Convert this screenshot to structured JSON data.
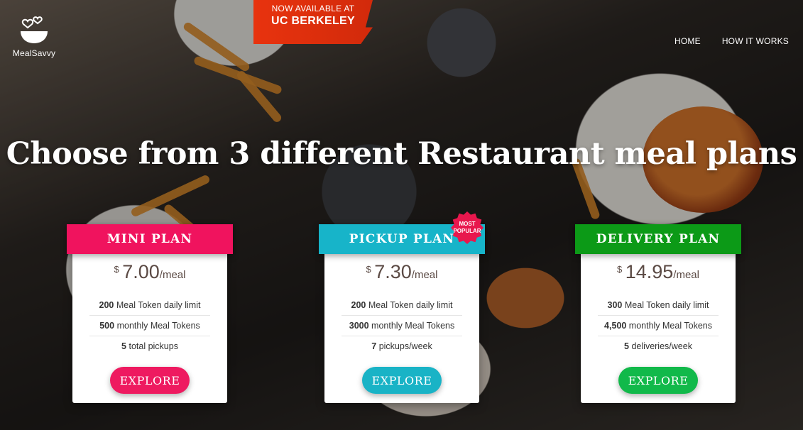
{
  "brand": {
    "name": "MealSavvy",
    "logo_icon": "bowl-hearts-icon"
  },
  "banner": {
    "line1": "NOW AVAILABLE AT",
    "line2": "UC BERKELEY"
  },
  "nav": {
    "home": "HOME",
    "how": "HOW IT WORKS"
  },
  "hero": {
    "title": "Choose from 3 different Restaurant meal plans"
  },
  "colors": {
    "mini": "#f0135e",
    "pickup": "#17b4c9",
    "delivery": "#0c9a17",
    "explore_mini": "#ee1a60",
    "explore_pickup": "#19b3c6",
    "explore_delivery": "#11b94a",
    "badge": "#e8174d"
  },
  "plans": [
    {
      "title": "MINI PLAN",
      "currency": "$",
      "price": "7.00",
      "unit": "/meal",
      "features": [
        {
          "value": "200",
          "text": "Meal Token daily limit"
        },
        {
          "value": "500",
          "text": "monthly Meal Tokens"
        },
        {
          "value": "5",
          "text": "total pickups"
        }
      ],
      "cta": "EXPLORE"
    },
    {
      "title": "PICKUP PLAN",
      "badge_line1": "MOST",
      "badge_line2": "POPULAR",
      "currency": "$",
      "price": "7.30",
      "unit": "/meal",
      "features": [
        {
          "value": "200",
          "text": "Meal Token daily limit"
        },
        {
          "value": "3000",
          "text": "monthly Meal Tokens"
        },
        {
          "value": "7",
          "text": "pickups/week"
        }
      ],
      "cta": "EXPLORE"
    },
    {
      "title": "DELIVERY PLAN",
      "currency": "$",
      "price": "14.95",
      "unit": "/meal",
      "features": [
        {
          "value": "300",
          "text": "Meal Token daily limit"
        },
        {
          "value": "4,500",
          "text": "monthly Meal Tokens"
        },
        {
          "value": "5",
          "text": "deliveries/week"
        }
      ],
      "cta": "EXPLORE"
    }
  ]
}
